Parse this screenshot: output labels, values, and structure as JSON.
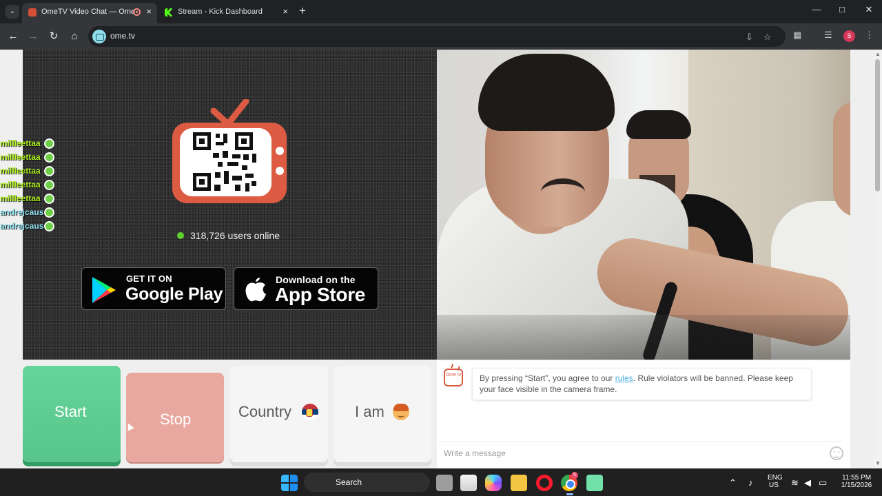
{
  "browser": {
    "tab_switcher_icon": "chevron-down-icon",
    "tabs": [
      {
        "title": "OmeTV Video Chat — Ome",
        "active": true,
        "icon": "ometv-icon"
      },
      {
        "title": "Stream - Kick Dashboard",
        "active": false,
        "icon": "kick-icon"
      }
    ],
    "new_tab_label": "+",
    "window_controls": {
      "minimize": "—",
      "maximize": "□",
      "close": "✕"
    },
    "url": "ome.tv",
    "profile_initial": "S"
  },
  "page": {
    "online_count": "318,726 users online",
    "google_play": {
      "small": "GET IT ON",
      "big": "Google Play"
    },
    "app_store": {
      "small": "Download on the",
      "big": "App Store"
    },
    "side_users": [
      {
        "name": "millleettaa",
        "color": "#b1f21f"
      },
      {
        "name": "millleettaa",
        "color": "#b1f21f"
      },
      {
        "name": "millleettaa",
        "color": "#b1f21f"
      },
      {
        "name": "millleettaa",
        "color": "#b1f21f"
      },
      {
        "name": "millleettaa",
        "color": "#b1f21f"
      },
      {
        "name": "andrejcaus",
        "color": "#8ee2f0"
      },
      {
        "name": "andrejcaus",
        "color": "#8ee2f0"
      }
    ],
    "buttons": {
      "start": "Start",
      "stop": "Stop",
      "country": "Country",
      "iam": "I am"
    },
    "chat": {
      "logo_text": "Ome tv",
      "message_before": "By pressing “Start”, you agree to our ",
      "rules_link": "rules",
      "message_after": ". Rule violators will be banned. Please keep your face visible in the camera frame.",
      "input_placeholder": "Write a message"
    }
  },
  "taskbar": {
    "search_label": "Search",
    "chrome_badge": "5",
    "language_top": "ENG",
    "language_bottom": "US",
    "time": "11:55 PM",
    "date": "1/15/2026"
  }
}
